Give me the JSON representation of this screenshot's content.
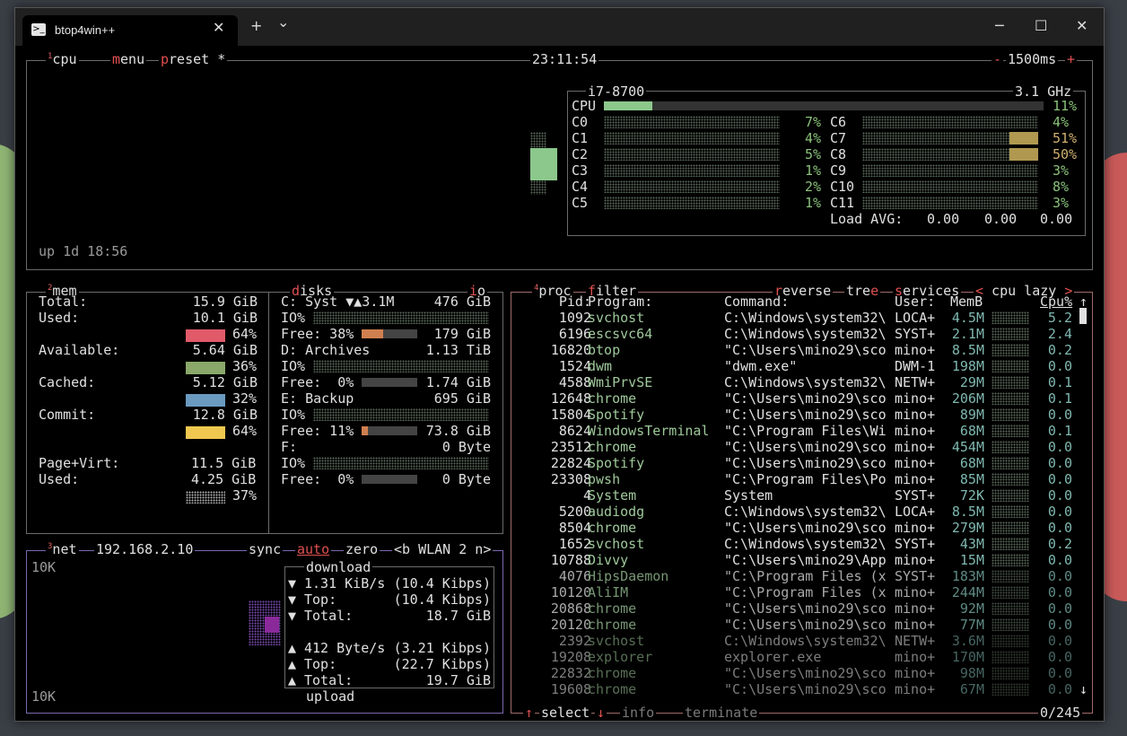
{
  "window": {
    "title": "btop4win++",
    "new_tab": "+",
    "dropdown": "⌄",
    "minimize": "─",
    "maximize": "☐",
    "close": "✕",
    "tab_close": "✕"
  },
  "cpu": {
    "num": "1",
    "title": "cpu",
    "menu": "menu",
    "preset": "preset *",
    "clock": "23:11:54",
    "minus": "-",
    "interval": "1500ms",
    "plus": "+",
    "model": "i7-8700",
    "freq": "3.1 GHz",
    "total_label": "CPU",
    "total_pct": "11%",
    "uptime": "up 1d 18:56",
    "cores_left": [
      {
        "name": "C0",
        "pct": "7%"
      },
      {
        "name": "C1",
        "pct": "4%"
      },
      {
        "name": "C2",
        "pct": "5%"
      },
      {
        "name": "C3",
        "pct": "1%"
      },
      {
        "name": "C4",
        "pct": "2%"
      },
      {
        "name": "C5",
        "pct": "1%"
      }
    ],
    "cores_right": [
      {
        "name": "C6",
        "pct": "4%"
      },
      {
        "name": "C7",
        "pct": "51%"
      },
      {
        "name": "C8",
        "pct": "50%"
      },
      {
        "name": "C9",
        "pct": "3%"
      },
      {
        "name": "C10",
        "pct": "8%"
      },
      {
        "name": "C11",
        "pct": "3%"
      }
    ],
    "load_label": "Load AVG:",
    "load": [
      "0.00",
      "0.00",
      "0.00"
    ]
  },
  "mem": {
    "num": "2",
    "title": "mem",
    "rows": [
      {
        "label": "Total:",
        "value": "15.9 GiB"
      },
      {
        "label": "Used:",
        "value": "10.1 GiB",
        "pct": "64%",
        "color": "#e05a6a"
      },
      {
        "label": "Available:",
        "value": "5.64 GiB",
        "pct": "36%",
        "color": "#8aa86a"
      },
      {
        "label": "Cached:",
        "value": "5.12 GiB",
        "pct": "32%",
        "color": "#6a9ac0"
      },
      {
        "label": "Commit:",
        "value": "12.8 GiB",
        "pct": "64%",
        "color": "#f0c850"
      }
    ],
    "pagevirt": {
      "label": "Page+Virt:",
      "value": "11.5 GiB",
      "used_label": "Used:",
      "used": "4.25 GiB",
      "pct": "37%"
    }
  },
  "disks": {
    "title": "disks",
    "io": "io",
    "list": [
      {
        "name": "C: Syst ▼▲3.1M",
        "size": "476 GiB",
        "io": "IO%",
        "free": "Free: 38%",
        "free_val": "179 GiB"
      },
      {
        "name": "D: Archives",
        "size": "1.13 TiB",
        "io": "IO%",
        "free": "Free:  0%",
        "free_val": "1.74 GiB"
      },
      {
        "name": "E: Backup",
        "size": "695 GiB",
        "io": "IO%",
        "free": "Free: 11%",
        "free_val": "73.8 GiB"
      },
      {
        "name": "F:",
        "size": "0 Byte",
        "io": "IO%",
        "free": "Free:  0%",
        "free_val": "0 Byte"
      }
    ]
  },
  "net": {
    "num": "3",
    "title": "net",
    "ip": "192.168.2.10",
    "sync": "sync",
    "auto": "auto",
    "zero": "zero",
    "iface": "<b WLAN 2 n>",
    "scale_top": "10K",
    "scale_bot": "10K",
    "download": "download",
    "upload": "upload",
    "down": [
      {
        "a": "▼",
        "l": "1.31 KiB/s",
        "v": "(10.4 Kibps)"
      },
      {
        "a": "▼",
        "l": "Top:",
        "v": "(10.4 Kibps)"
      },
      {
        "a": "▼",
        "l": "Total:",
        "v": "18.7 GiB"
      }
    ],
    "up": [
      {
        "a": "▲",
        "l": "412 Byte/s",
        "v": "(3.21 Kibps)"
      },
      {
        "a": "▲",
        "l": "Top:",
        "v": "(22.7 Kibps)"
      },
      {
        "a": "▲",
        "l": "Total:",
        "v": "19.7 GiB"
      }
    ]
  },
  "proc": {
    "num": "4",
    "title": "proc",
    "filter": "filter",
    "reverse": "reverse",
    "tree": "tree",
    "services": "services",
    "sort": "< cpu lazy >",
    "cols": {
      "pid": "Pid:",
      "program": "Program:",
      "command": "Command:",
      "user": "User:",
      "mem": "MemB",
      "cpu": "Cpu%"
    },
    "rows": [
      [
        "1092",
        "svchost",
        "C:\\Windows\\system32\\",
        "LOCA+",
        "4.5M",
        "5.2"
      ],
      [
        "6196",
        "escsvc64",
        "C:\\Windows\\system32\\",
        "SYST+",
        "2.1M",
        "2.4"
      ],
      [
        "16820",
        "btop",
        "\"C:\\Users\\mino29\\sco",
        "mino+",
        "8.5M",
        "0.2"
      ],
      [
        "1524",
        "dwm",
        "\"dwm.exe\"",
        "DWM-1",
        "198M",
        "0.0"
      ],
      [
        "4588",
        "WmiPrvSE",
        "C:\\Windows\\system32\\",
        "NETW+",
        "29M",
        "0.1"
      ],
      [
        "12648",
        "chrome",
        "\"C:\\Users\\mino29\\sco",
        "mino+",
        "206M",
        "0.1"
      ],
      [
        "15804",
        "Spotify",
        "\"C:\\Users\\mino29\\sco",
        "mino+",
        "89M",
        "0.0"
      ],
      [
        "8624",
        "WindowsTerminal",
        "\"C:\\Program Files\\Wi",
        "mino+",
        "68M",
        "0.1"
      ],
      [
        "23512",
        "chrome",
        "\"C:\\Users\\mino29\\sco",
        "mino+",
        "454M",
        "0.0"
      ],
      [
        "22824",
        "Spotify",
        "\"C:\\Users\\mino29\\sco",
        "mino+",
        "68M",
        "0.0"
      ],
      [
        "23308",
        "pwsh",
        "\"C:\\Program Files\\Po",
        "mino+",
        "85M",
        "0.0"
      ],
      [
        "4",
        "System",
        "System",
        "SYST+",
        "72K",
        "0.0"
      ],
      [
        "5200",
        "audiodg",
        "C:\\Windows\\system32\\",
        "LOCA+",
        "8.5M",
        "0.0"
      ],
      [
        "8504",
        "chrome",
        "\"C:\\Users\\mino29\\sco",
        "mino+",
        "279M",
        "0.0"
      ],
      [
        "1652",
        "svchost",
        "C:\\Windows\\system32\\",
        "SYST+",
        "43M",
        "0.2"
      ],
      [
        "10788",
        "Divvy",
        "\"C:\\Users\\mino29\\App",
        "mino+",
        "15M",
        "0.0"
      ],
      [
        "4076",
        "HipsDaemon",
        "\"C:\\Program Files (x",
        "SYST+",
        "183M",
        "0.0"
      ],
      [
        "10120",
        "AliIM",
        "\"C:\\Program Files (x",
        "mino+",
        "244M",
        "0.0"
      ],
      [
        "20868",
        "chrome",
        "\"C:\\Users\\mino29\\sco",
        "mino+",
        "92M",
        "0.0"
      ],
      [
        "20120",
        "chrome",
        "\"C:\\Users\\mino29\\sco",
        "mino+",
        "77M",
        "0.0"
      ],
      [
        "2392",
        "svchost",
        "C:\\Windows\\system32\\",
        "NETW+",
        "3.6M",
        "0.0"
      ],
      [
        "19208",
        "explorer",
        "explorer.exe",
        "mino+",
        "170M",
        "0.0"
      ],
      [
        "22832",
        "chrome",
        "\"C:\\Users\\mino29\\sco",
        "mino+",
        "98M",
        "0.0"
      ],
      [
        "19608",
        "chrome",
        "\"C:\\Users\\mino29\\sco",
        "mino+",
        "67M",
        "0.0"
      ]
    ],
    "select": "select",
    "info": "info",
    "terminate": "terminate",
    "count": "0/245",
    "up_arrow": "↑",
    "down_arrow": "↓"
  }
}
